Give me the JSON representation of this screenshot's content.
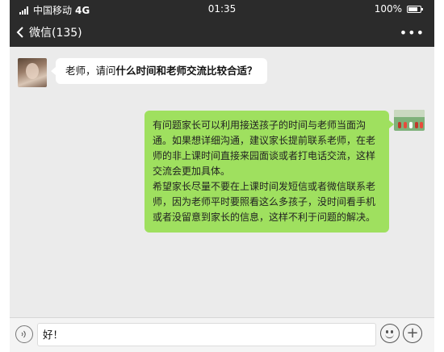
{
  "status_bar": {
    "carrier": "中国移动",
    "network": "4G",
    "time": "01:35",
    "battery": "100%"
  },
  "nav": {
    "back_label": "微信(135)",
    "more_label": "•••"
  },
  "messages": {
    "left": {
      "prefix": "老师，请问",
      "bold": "什么时间和老师交流比较合适？"
    },
    "right": {
      "paragraph1": "有问题家长可以利用接送孩子的时间与老师当面沟通。如果想详细沟通，建议家长提前联系老师，在老师的非上课时间直接来园面谈或者打电话交流，这样交流会更加具体。",
      "paragraph2": "希望家长尽量不要在上课时间发短信或者微信联系老师，因为老师平时要照看这么多孩子，没时间看手机或者没留意到家长的信息，这样不利于问题的解决。"
    }
  },
  "input_bar": {
    "text": "好！",
    "plus_label": "+"
  },
  "colors": {
    "header_bg": "#2b2b2b",
    "chat_bg": "#ebebeb",
    "sent_bubble": "#9fe05f",
    "received_bubble": "#ffffff"
  }
}
